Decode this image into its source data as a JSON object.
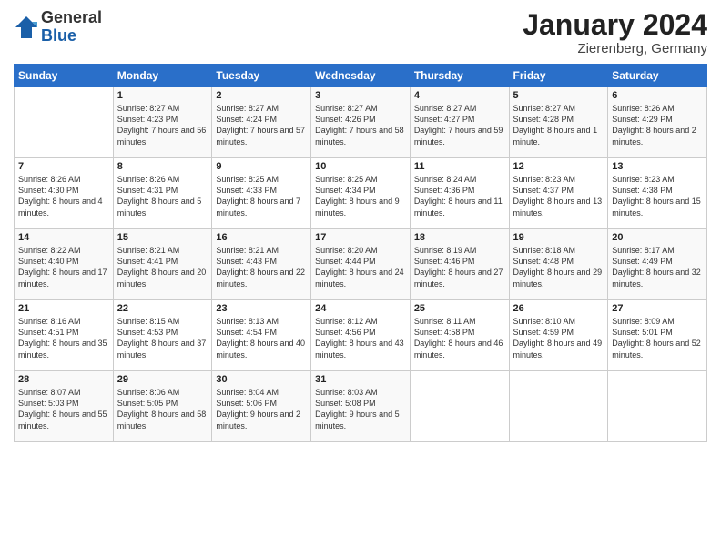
{
  "logo": {
    "general": "General",
    "blue": "Blue"
  },
  "header": {
    "month": "January 2024",
    "location": "Zierenberg, Germany"
  },
  "weekdays": [
    "Sunday",
    "Monday",
    "Tuesday",
    "Wednesday",
    "Thursday",
    "Friday",
    "Saturday"
  ],
  "weeks": [
    [
      {
        "day": "",
        "sunrise": "",
        "sunset": "",
        "daylight": ""
      },
      {
        "day": "1",
        "sunrise": "Sunrise: 8:27 AM",
        "sunset": "Sunset: 4:23 PM",
        "daylight": "Daylight: 7 hours and 56 minutes."
      },
      {
        "day": "2",
        "sunrise": "Sunrise: 8:27 AM",
        "sunset": "Sunset: 4:24 PM",
        "daylight": "Daylight: 7 hours and 57 minutes."
      },
      {
        "day": "3",
        "sunrise": "Sunrise: 8:27 AM",
        "sunset": "Sunset: 4:26 PM",
        "daylight": "Daylight: 7 hours and 58 minutes."
      },
      {
        "day": "4",
        "sunrise": "Sunrise: 8:27 AM",
        "sunset": "Sunset: 4:27 PM",
        "daylight": "Daylight: 7 hours and 59 minutes."
      },
      {
        "day": "5",
        "sunrise": "Sunrise: 8:27 AM",
        "sunset": "Sunset: 4:28 PM",
        "daylight": "Daylight: 8 hours and 1 minute."
      },
      {
        "day": "6",
        "sunrise": "Sunrise: 8:26 AM",
        "sunset": "Sunset: 4:29 PM",
        "daylight": "Daylight: 8 hours and 2 minutes."
      }
    ],
    [
      {
        "day": "7",
        "sunrise": "Sunrise: 8:26 AM",
        "sunset": "Sunset: 4:30 PM",
        "daylight": "Daylight: 8 hours and 4 minutes."
      },
      {
        "day": "8",
        "sunrise": "Sunrise: 8:26 AM",
        "sunset": "Sunset: 4:31 PM",
        "daylight": "Daylight: 8 hours and 5 minutes."
      },
      {
        "day": "9",
        "sunrise": "Sunrise: 8:25 AM",
        "sunset": "Sunset: 4:33 PM",
        "daylight": "Daylight: 8 hours and 7 minutes."
      },
      {
        "day": "10",
        "sunrise": "Sunrise: 8:25 AM",
        "sunset": "Sunset: 4:34 PM",
        "daylight": "Daylight: 8 hours and 9 minutes."
      },
      {
        "day": "11",
        "sunrise": "Sunrise: 8:24 AM",
        "sunset": "Sunset: 4:36 PM",
        "daylight": "Daylight: 8 hours and 11 minutes."
      },
      {
        "day": "12",
        "sunrise": "Sunrise: 8:23 AM",
        "sunset": "Sunset: 4:37 PM",
        "daylight": "Daylight: 8 hours and 13 minutes."
      },
      {
        "day": "13",
        "sunrise": "Sunrise: 8:23 AM",
        "sunset": "Sunset: 4:38 PM",
        "daylight": "Daylight: 8 hours and 15 minutes."
      }
    ],
    [
      {
        "day": "14",
        "sunrise": "Sunrise: 8:22 AM",
        "sunset": "Sunset: 4:40 PM",
        "daylight": "Daylight: 8 hours and 17 minutes."
      },
      {
        "day": "15",
        "sunrise": "Sunrise: 8:21 AM",
        "sunset": "Sunset: 4:41 PM",
        "daylight": "Daylight: 8 hours and 20 minutes."
      },
      {
        "day": "16",
        "sunrise": "Sunrise: 8:21 AM",
        "sunset": "Sunset: 4:43 PM",
        "daylight": "Daylight: 8 hours and 22 minutes."
      },
      {
        "day": "17",
        "sunrise": "Sunrise: 8:20 AM",
        "sunset": "Sunset: 4:44 PM",
        "daylight": "Daylight: 8 hours and 24 minutes."
      },
      {
        "day": "18",
        "sunrise": "Sunrise: 8:19 AM",
        "sunset": "Sunset: 4:46 PM",
        "daylight": "Daylight: 8 hours and 27 minutes."
      },
      {
        "day": "19",
        "sunrise": "Sunrise: 8:18 AM",
        "sunset": "Sunset: 4:48 PM",
        "daylight": "Daylight: 8 hours and 29 minutes."
      },
      {
        "day": "20",
        "sunrise": "Sunrise: 8:17 AM",
        "sunset": "Sunset: 4:49 PM",
        "daylight": "Daylight: 8 hours and 32 minutes."
      }
    ],
    [
      {
        "day": "21",
        "sunrise": "Sunrise: 8:16 AM",
        "sunset": "Sunset: 4:51 PM",
        "daylight": "Daylight: 8 hours and 35 minutes."
      },
      {
        "day": "22",
        "sunrise": "Sunrise: 8:15 AM",
        "sunset": "Sunset: 4:53 PM",
        "daylight": "Daylight: 8 hours and 37 minutes."
      },
      {
        "day": "23",
        "sunrise": "Sunrise: 8:13 AM",
        "sunset": "Sunset: 4:54 PM",
        "daylight": "Daylight: 8 hours and 40 minutes."
      },
      {
        "day": "24",
        "sunrise": "Sunrise: 8:12 AM",
        "sunset": "Sunset: 4:56 PM",
        "daylight": "Daylight: 8 hours and 43 minutes."
      },
      {
        "day": "25",
        "sunrise": "Sunrise: 8:11 AM",
        "sunset": "Sunset: 4:58 PM",
        "daylight": "Daylight: 8 hours and 46 minutes."
      },
      {
        "day": "26",
        "sunrise": "Sunrise: 8:10 AM",
        "sunset": "Sunset: 4:59 PM",
        "daylight": "Daylight: 8 hours and 49 minutes."
      },
      {
        "day": "27",
        "sunrise": "Sunrise: 8:09 AM",
        "sunset": "Sunset: 5:01 PM",
        "daylight": "Daylight: 8 hours and 52 minutes."
      }
    ],
    [
      {
        "day": "28",
        "sunrise": "Sunrise: 8:07 AM",
        "sunset": "Sunset: 5:03 PM",
        "daylight": "Daylight: 8 hours and 55 minutes."
      },
      {
        "day": "29",
        "sunrise": "Sunrise: 8:06 AM",
        "sunset": "Sunset: 5:05 PM",
        "daylight": "Daylight: 8 hours and 58 minutes."
      },
      {
        "day": "30",
        "sunrise": "Sunrise: 8:04 AM",
        "sunset": "Sunset: 5:06 PM",
        "daylight": "Daylight: 9 hours and 2 minutes."
      },
      {
        "day": "31",
        "sunrise": "Sunrise: 8:03 AM",
        "sunset": "Sunset: 5:08 PM",
        "daylight": "Daylight: 9 hours and 5 minutes."
      },
      {
        "day": "",
        "sunrise": "",
        "sunset": "",
        "daylight": ""
      },
      {
        "day": "",
        "sunrise": "",
        "sunset": "",
        "daylight": ""
      },
      {
        "day": "",
        "sunrise": "",
        "sunset": "",
        "daylight": ""
      }
    ]
  ]
}
